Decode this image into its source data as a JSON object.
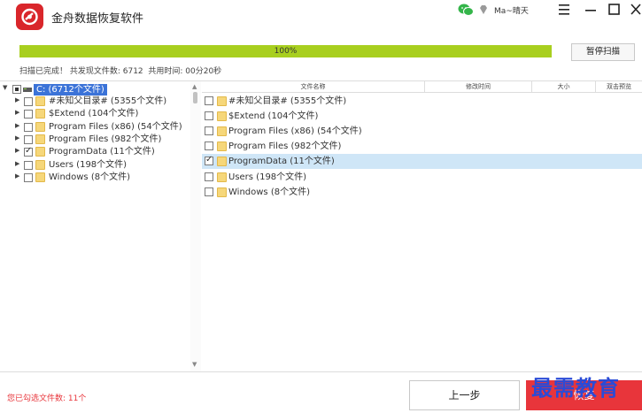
{
  "app": {
    "title": "金舟数据恢复软件",
    "user": "Ma~晴天"
  },
  "scan": {
    "progress_text": "100%",
    "progress": 1.0,
    "pause_label": "暂停扫描",
    "status": "扫描已完成！ 共发现文件数: 6712  共用时间: 00分20秒"
  },
  "tree": {
    "root": {
      "label": "C:  (6712个文件)"
    },
    "items": [
      {
        "label": "#未知父目录#  (5355个文件)",
        "checked": false
      },
      {
        "label": "$Extend  (104个文件)",
        "checked": false
      },
      {
        "label": "Program Files (x86)  (54个文件)",
        "checked": false
      },
      {
        "label": "Program Files  (982个文件)",
        "checked": false
      },
      {
        "label": "ProgramData  (11个文件)",
        "checked": true
      },
      {
        "label": "Users  (198个文件)",
        "checked": false
      },
      {
        "label": "Windows  (8个文件)",
        "checked": false
      }
    ]
  },
  "columns": {
    "name": "文件名称",
    "date": "修改时间",
    "size": "大小",
    "preview": "双击预览"
  },
  "files": [
    {
      "label": "#未知父目录#  (5355个文件)",
      "checked": false,
      "selected": false
    },
    {
      "label": "$Extend  (104个文件)",
      "checked": false,
      "selected": false
    },
    {
      "label": "Program Files (x86)  (54个文件)",
      "checked": false,
      "selected": false
    },
    {
      "label": "Program Files  (982个文件)",
      "checked": false,
      "selected": false
    },
    {
      "label": "ProgramData  (11个文件)",
      "checked": true,
      "selected": true
    },
    {
      "label": "Users  (198个文件)",
      "checked": false,
      "selected": false
    },
    {
      "label": "Windows  (8个文件)",
      "checked": false,
      "selected": false
    }
  ],
  "footer": {
    "selected_count": "您已勾选文件数: 11个",
    "prev_label": "上一步",
    "recover_label": "恢复"
  },
  "watermark": "最需教育",
  "colors": {
    "accent": "#e8353b",
    "progress": "#a8cf1f",
    "selection": "#3b73d8",
    "row_highlight": "#cfe6f7"
  }
}
